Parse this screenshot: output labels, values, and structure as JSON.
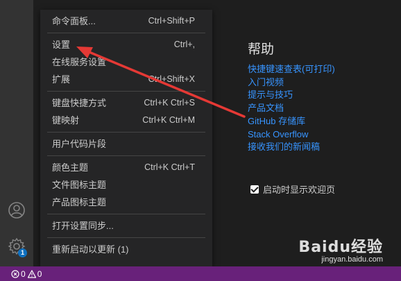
{
  "menu": {
    "groups": [
      [
        {
          "label": "命令面板...",
          "shortcut": "Ctrl+Shift+P"
        }
      ],
      [
        {
          "label": "设置",
          "shortcut": "Ctrl+,"
        },
        {
          "label": "在线服务设置",
          "shortcut": ""
        },
        {
          "label": "扩展",
          "shortcut": "Ctrl+Shift+X"
        }
      ],
      [
        {
          "label": "键盘快捷方式",
          "shortcut": "Ctrl+K Ctrl+S"
        },
        {
          "label": "键映射",
          "shortcut": "Ctrl+K Ctrl+M"
        }
      ],
      [
        {
          "label": "用户代码片段",
          "shortcut": ""
        }
      ],
      [
        {
          "label": "颜色主题",
          "shortcut": "Ctrl+K Ctrl+T"
        },
        {
          "label": "文件图标主题",
          "shortcut": ""
        },
        {
          "label": "产品图标主题",
          "shortcut": ""
        }
      ],
      [
        {
          "label": "打开设置同步...",
          "shortcut": ""
        }
      ],
      [
        {
          "label": "重新启动以更新 (1)",
          "shortcut": ""
        }
      ]
    ]
  },
  "help": {
    "title": "帮助",
    "links": [
      "快捷键速查表(可打印)",
      "入门视频",
      "提示与技巧",
      "产品文档",
      "GitHub 存储库",
      "Stack Overflow",
      "接收我们的新闻稿"
    ]
  },
  "startup": {
    "label": "启动时显示欢迎页",
    "checked": true
  },
  "activity": {
    "badge": "1",
    "icons": [
      "account-icon",
      "gear-icon"
    ]
  },
  "statusbar": {
    "errors": "0",
    "warnings": "0"
  },
  "watermark": {
    "main": "Baidu经验",
    "sub": "jingyan.baidu.com"
  },
  "colors": {
    "accent_link": "#3794ff",
    "statusbar": "#68217a",
    "arrow": "#e53935",
    "badge": "#0e70c0"
  }
}
